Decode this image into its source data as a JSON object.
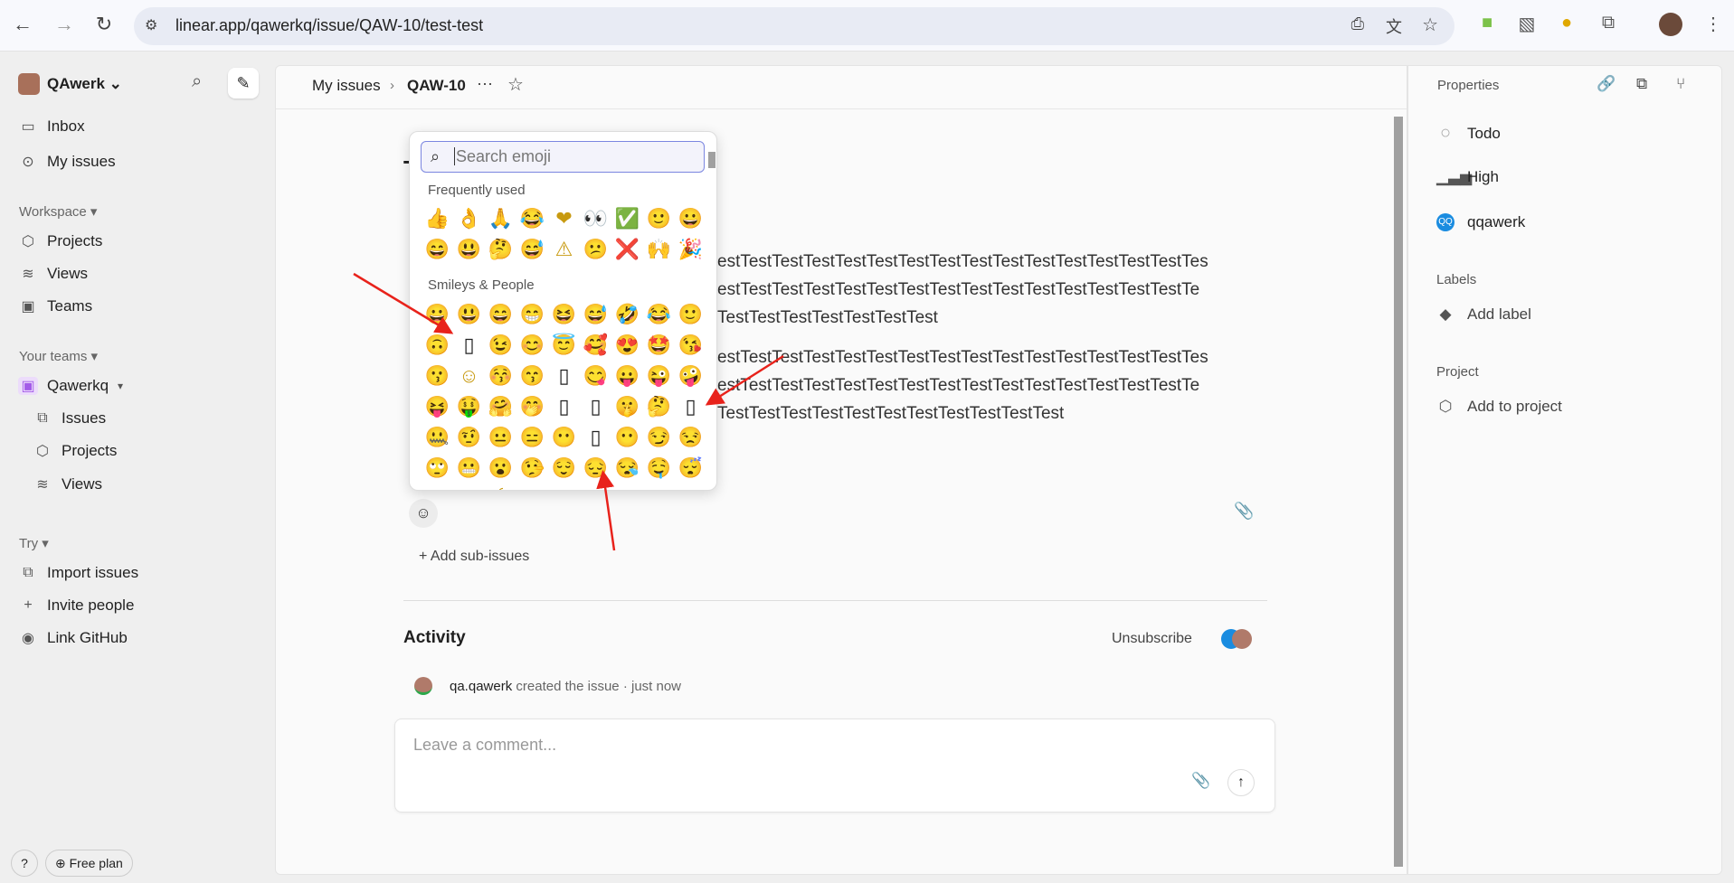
{
  "browser": {
    "url": "linear.app/qawerkq/issue/QAW-10/test-test"
  },
  "sidebar": {
    "workspace": "QAwerk",
    "top": [
      {
        "label": "Inbox",
        "icon": "inbox-icon"
      },
      {
        "label": "My issues",
        "icon": "target-icon"
      }
    ],
    "workspace_header": "Workspace",
    "workspace_items": [
      {
        "label": "Projects",
        "icon": "cube-icon"
      },
      {
        "label": "Views",
        "icon": "layers-icon"
      },
      {
        "label": "Teams",
        "icon": "team-icon"
      }
    ],
    "teams_header": "Your teams",
    "team": "Qawerkq",
    "team_items": [
      {
        "label": "Issues",
        "icon": "issues-icon"
      },
      {
        "label": "Projects",
        "icon": "cube-icon"
      },
      {
        "label": "Views",
        "icon": "layers-icon"
      }
    ],
    "try_header": "Try",
    "try_items": [
      {
        "label": "Import issues",
        "icon": "import-icon"
      },
      {
        "label": "Invite people",
        "icon": "plus-icon"
      },
      {
        "label": "Link GitHub",
        "icon": "github-icon"
      }
    ],
    "help": "?",
    "free_plan": "Free plan"
  },
  "header": {
    "crumb": "My issues",
    "issue_id": "QAW-10"
  },
  "issue": {
    "title_fragment": "T",
    "para1": [
      "estTestTestTestTestTestTestTestTestTestTestTestTestTestTestTes",
      "estTestTestTestTestTestTestTestTestTestTestTestTestTestTestTe",
      "TestTestTestTestTestTestTest"
    ],
    "para2": [
      "estTestTestTestTestTestTestTestTestTestTestTestTestTestTestTes",
      "estTestTestTestTestTestTestTestTestTestTestTestTestTestTestTe",
      "TestTestTestTestTestTestTestTestTestTestTest"
    ],
    "add_sub": "+ Add sub-issues"
  },
  "emoji_picker": {
    "placeholder": "Search emoji",
    "frequent_label": "Frequently used",
    "smileys_label": "Smileys & People",
    "frequent": [
      "👍",
      "👌",
      "🙏",
      "😂",
      "❤",
      "👀",
      "✅",
      "🙂",
      "😀",
      "😄",
      "😃",
      "🤔",
      "😅",
      "⚠",
      "😕",
      "❌",
      "🙌",
      "🎉"
    ],
    "smileys": [
      "😀",
      "😃",
      "😄",
      "😁",
      "😆",
      "😅",
      "🤣",
      "😂",
      "🙂",
      "🙃",
      "▯",
      "😉",
      "😊",
      "😇",
      "🥰",
      "😍",
      "🤩",
      "😘",
      "😗",
      "☺",
      "😚",
      "😙",
      "▯",
      "😋",
      "😛",
      "😜",
      "🤪",
      "😝",
      "🤑",
      "🤗",
      "🤭",
      "▯",
      "▯",
      "🤫",
      "🤔",
      "▯",
      "🤐",
      "🤨",
      "😐",
      "😑",
      "😶",
      "▯",
      "😶≋",
      "😏",
      "😒",
      "🙄",
      "😬",
      "😮꒰",
      "🤥",
      "😌",
      "😔",
      "😪",
      "🤤",
      "😴"
    ]
  },
  "activity": {
    "title": "Activity",
    "unsubscribe": "Unsubscribe",
    "user": "qa.qawerk",
    "action": "created the issue",
    "sep": "·",
    "time": "just now",
    "comment_placeholder": "Leave a comment..."
  },
  "properties": {
    "title": "Properties",
    "status": "Todo",
    "priority": "High",
    "assignee": "qqawerk",
    "labels_title": "Labels",
    "add_label": "Add label",
    "project_title": "Project",
    "add_project": "Add to project"
  },
  "colors": {
    "arrow": "#e8221b",
    "accent": "#7b86e0"
  }
}
